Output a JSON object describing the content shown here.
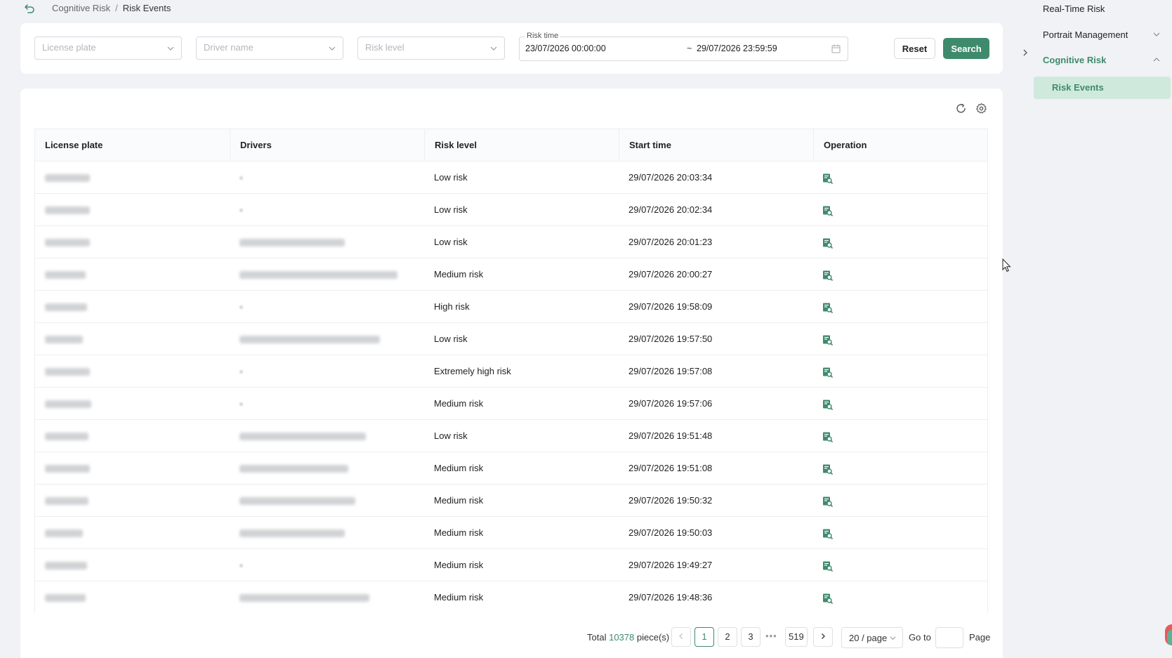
{
  "breadcrumb": {
    "parent": "Cognitive Risk",
    "separator": "/",
    "current": "Risk Events"
  },
  "filters": {
    "license_plate_placeholder": "License plate",
    "driver_name_placeholder": "Driver name",
    "risk_level_placeholder": "Risk level",
    "risk_time_label": "Risk time",
    "risk_time_start": "23/07/2026 00:00:00",
    "risk_time_separator": "~",
    "risk_time_end": "29/07/2026 23:59:59",
    "reset_label": "Reset",
    "search_label": "Search"
  },
  "table": {
    "columns": [
      "License plate",
      "Drivers",
      "Risk level",
      "Start time",
      "Operation"
    ],
    "rows": [
      {
        "plate_redacted": true,
        "driver_redacted": "empty",
        "risk_level": "Low risk",
        "start_time": "29/07/2026 20:03:34"
      },
      {
        "plate_redacted": true,
        "driver_redacted": "empty",
        "risk_level": "Low risk",
        "start_time": "29/07/2026 20:02:34"
      },
      {
        "plate_redacted": true,
        "driver_redacted": "text",
        "risk_level": "Low risk",
        "start_time": "29/07/2026 20:01:23"
      },
      {
        "plate_redacted": true,
        "driver_redacted": "text",
        "risk_level": "Medium risk",
        "start_time": "29/07/2026 20:00:27"
      },
      {
        "plate_redacted": true,
        "driver_redacted": "empty",
        "risk_level": "High risk",
        "start_time": "29/07/2026 19:58:09"
      },
      {
        "plate_redacted": true,
        "driver_redacted": "text",
        "risk_level": "Low risk",
        "start_time": "29/07/2026 19:57:50"
      },
      {
        "plate_redacted": true,
        "driver_redacted": "empty",
        "risk_level": "Extremely high risk",
        "start_time": "29/07/2026 19:57:08"
      },
      {
        "plate_redacted": true,
        "driver_redacted": "empty",
        "risk_level": "Medium risk",
        "start_time": "29/07/2026 19:57:06"
      },
      {
        "plate_redacted": true,
        "driver_redacted": "text",
        "risk_level": "Low risk",
        "start_time": "29/07/2026 19:51:48"
      },
      {
        "plate_redacted": true,
        "driver_redacted": "text",
        "risk_level": "Medium risk",
        "start_time": "29/07/2026 19:51:08"
      },
      {
        "plate_redacted": true,
        "driver_redacted": "text",
        "risk_level": "Medium risk",
        "start_time": "29/07/2026 19:50:32"
      },
      {
        "plate_redacted": true,
        "driver_redacted": "text",
        "risk_level": "Medium risk",
        "start_time": "29/07/2026 19:50:03"
      },
      {
        "plate_redacted": true,
        "driver_redacted": "empty",
        "risk_level": "Medium risk",
        "start_time": "29/07/2026 19:49:27"
      },
      {
        "plate_redacted": true,
        "driver_redacted": "text",
        "risk_level": "Medium risk",
        "start_time": "29/07/2026 19:48:36"
      }
    ],
    "operation_icon": "view-report-icon"
  },
  "pagination": {
    "total_prefix": "Total",
    "total_count": "10378",
    "total_suffix": "piece(s)",
    "pages": [
      "1",
      "2",
      "3"
    ],
    "current_page": "1",
    "ellipsis": "•••",
    "last_page": "519",
    "page_size": "20 / page",
    "goto_label": "Go to",
    "page_label": "Page"
  },
  "sidebar": {
    "items": [
      {
        "label": "Real-Time Risk"
      },
      {
        "label": "Portrait Management"
      },
      {
        "label": "Cognitive Risk"
      }
    ],
    "sub_item": "Risk Events"
  },
  "colors": {
    "accent": "#3f8a6d",
    "accent_light": "#cfe9dc",
    "background": "#f0f2f5"
  }
}
